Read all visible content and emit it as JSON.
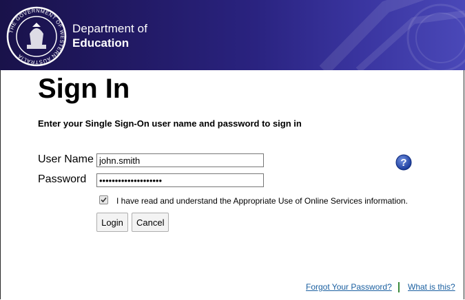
{
  "header": {
    "seal_text": "THE GOVERNMENT OF WESTERN AUSTRALIA",
    "dept_line1": "Department of",
    "dept_line2": "Education",
    "colors": {
      "banner_dark": "#19124a",
      "banner_light": "#4a48b8"
    }
  },
  "main": {
    "title": "Sign In",
    "instruction": "Enter your Single Sign-On user name and password to sign in"
  },
  "form": {
    "username_label": "User Name",
    "username_value": "john.smith",
    "password_label": "Password",
    "password_value": "••••••••••••••••••••",
    "agree_checked": true,
    "agree_label": "I have read and understand the Appropriate Use of Online Services information.",
    "login_label": "Login",
    "cancel_label": "Cancel",
    "help_icon": "question-circle-icon"
  },
  "footer": {
    "forgot_link": "Forgot Your Password?",
    "separator": "|",
    "what_link": "What is this?",
    "link_color": "#1a5fa0"
  }
}
